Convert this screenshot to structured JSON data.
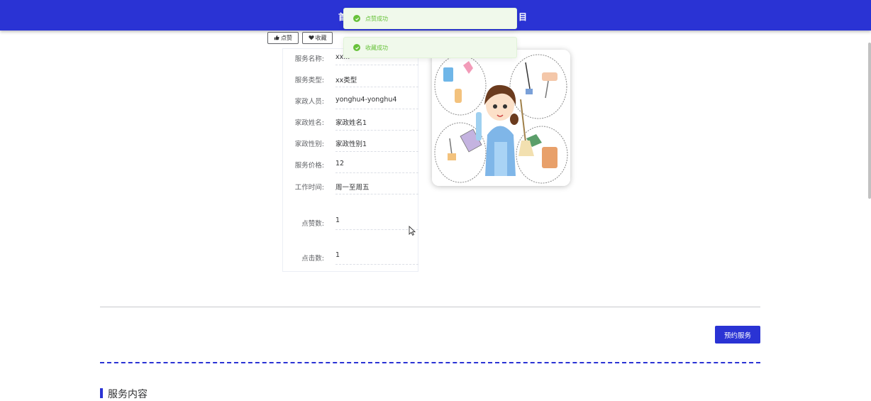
{
  "header": {
    "nav_left_fragment": "首",
    "nav_right_fragment": "目"
  },
  "toasts": [
    {
      "message": "点赞成功",
      "type": "success"
    },
    {
      "message": "收藏成功",
      "type": "success"
    }
  ],
  "actions": {
    "like_label": "点赞",
    "favorite_label": "收藏",
    "like_icon": "thumbs-up-icon",
    "favorite_icon": "heart-icon"
  },
  "details": [
    {
      "label": "服务名称:",
      "value": "xx..."
    },
    {
      "label": "服务类型:",
      "value": "xx类型"
    },
    {
      "label": "家政人员:",
      "value": "yonghu4-yonghu4"
    },
    {
      "label": "家政姓名:",
      "value": "家政姓名1"
    },
    {
      "label": "家政性别:",
      "value": "家政性别1"
    },
    {
      "label": "服务价格:",
      "value": "12"
    },
    {
      "label": "工作时间:",
      "value": "周一至周五"
    },
    {
      "label": "点赞数:",
      "value": "1"
    },
    {
      "label": "点击数:",
      "value": "1"
    }
  ],
  "booking": {
    "button_label": "预约服务"
  },
  "section": {
    "title": "服务内容"
  },
  "colors": {
    "primary": "#2a33d4",
    "success": "#67c23a",
    "toast_bg": "#f0f9eb"
  }
}
